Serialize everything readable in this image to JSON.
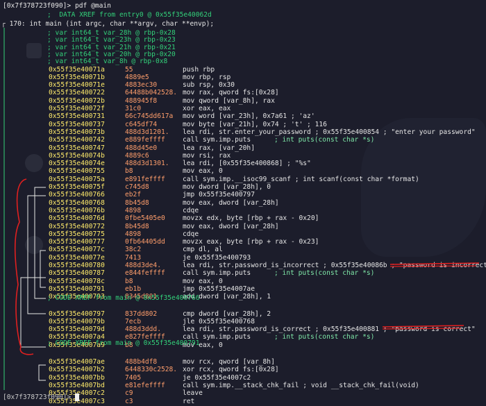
{
  "terminal": {
    "prompt_top": "[0x7f378723f090]> pdf @main",
    "prompt_bottom": "[0x7f378723f090]> ",
    "xref_entry": ";  DATA XREF from entry0 @ 0x55f35e40062d",
    "func_header": "170: int main (int argc, char **argv, char **envp);",
    "vars": [
      "; var int64_t var_28h @ rbp-0x28",
      "; var int64_t var_23h @ rbp-0x23",
      "; var int64_t var_21h @ rbp-0x21",
      "; var int64_t var_20h @ rbp-0x20",
      "; var int64_t var_8h @ rbp-0x8"
    ],
    "code_xref_1": "; CODE XREF from main @ 0x55f35e400766",
    "code_xref_2": "; CODE XREF from main @ 0x55f35e400791",
    "instructions": [
      {
        "addr": "0x55f35e40071a",
        "hex": "55",
        "mn": "push rbp",
        "cmt": ""
      },
      {
        "addr": "0x55f35e40071b",
        "hex": "4889e5",
        "mn": "mov rbp, rsp",
        "cmt": ""
      },
      {
        "addr": "0x55f35e40071e",
        "hex": "4883ec30",
        "mn": "sub rsp, 0x30",
        "cmt": ""
      },
      {
        "addr": "0x55f35e400722",
        "hex": "64488b042528.",
        "mn": "mov rax, qword fs:[0x28]",
        "cmt": ""
      },
      {
        "addr": "0x55f35e40072b",
        "hex": "488945f8",
        "mn": "mov qword [var_8h], rax",
        "cmt": ""
      },
      {
        "addr": "0x55f35e40072f",
        "hex": "31c0",
        "mn": "xor eax, eax",
        "cmt": ""
      },
      {
        "addr": "0x55f35e400731",
        "hex": "66c745dd617a",
        "mn": "mov word [var_23h], 0x7a61 ; 'az'",
        "cmt": ""
      },
      {
        "addr": "0x55f35e400737",
        "hex": "c645df74",
        "mn": "mov byte [var_21h], 0x74 ; 't' ; 116",
        "cmt": ""
      },
      {
        "addr": "0x55f35e40073b",
        "hex": "488d3d1201.",
        "mn": "lea rdi, str.enter_your_password ; 0x55f35e400854 ; \"enter your password\"",
        "cmt": ""
      },
      {
        "addr": "0x55f35e400742",
        "hex": "e889feffff",
        "mn": "call sym.imp.puts",
        "cmt": "; int puts(const char *s)"
      },
      {
        "addr": "0x55f35e400747",
        "hex": "488d45e0",
        "mn": "lea rax, [var_20h]",
        "cmt": ""
      },
      {
        "addr": "0x55f35e40074b",
        "hex": "4889c6",
        "mn": "mov rsi, rax",
        "cmt": ""
      },
      {
        "addr": "0x55f35e40074e",
        "hex": "488d3d1301.",
        "mn": "lea rdi, [0x55f35e400868] ; \"%s\"",
        "cmt": ""
      },
      {
        "addr": "0x55f35e400755",
        "hex": "b8",
        "mn": "mov eax, 0",
        "cmt": ""
      },
      {
        "addr": "0x55f35e40075a",
        "hex": "e891feffff",
        "mn": "call sym.imp.__isoc99_scanf ; int scanf(const char *format)",
        "cmt": ""
      },
      {
        "addr": "0x55f35e40075f",
        "hex": "c745d8",
        "mn": "mov dword [var_28h], 0",
        "cmt": ""
      },
      {
        "addr": "0x55f35e400766",
        "hex": "eb2f",
        "mn": "jmp 0x55f35e400797",
        "cmt": ""
      },
      {
        "addr": "0x55f35e400768",
        "hex": "8b45d8",
        "mn": "mov eax, dword [var_28h]",
        "cmt": ""
      },
      {
        "addr": "0x55f35e40076b",
        "hex": "4898",
        "mn": "cdqe",
        "cmt": ""
      },
      {
        "addr": "0x55f35e40076d",
        "hex": "0fbe5405e0",
        "mn": "movzx edx, byte [rbp + rax - 0x20]",
        "cmt": ""
      },
      {
        "addr": "0x55f35e400772",
        "hex": "8b45d8",
        "mn": "mov eax, dword [var_28h]",
        "cmt": ""
      },
      {
        "addr": "0x55f35e400775",
        "hex": "4898",
        "mn": "cdqe",
        "cmt": ""
      },
      {
        "addr": "0x55f35e400777",
        "hex": "0fb64405dd",
        "mn": "movzx eax, byte [rbp + rax - 0x23]",
        "cmt": ""
      },
      {
        "addr": "0x55f35e40077c",
        "hex": "38c2",
        "mn": "cmp dl, al",
        "cmt": ""
      },
      {
        "addr": "0x55f35e40077e",
        "hex": "7413",
        "mn": "je 0x55f35e400793",
        "cmt": ""
      },
      {
        "addr": "0x55f35e400780",
        "hex": "488d3de4.",
        "mn": "lea rdi, str.password_is_incorrect ; 0x55f35e40086b ; \"password is incorrect\"",
        "cmt": ""
      },
      {
        "addr": "0x55f35e400787",
        "hex": "e844feffff",
        "mn": "call sym.imp.puts",
        "cmt": "; int puts(const char *s)"
      },
      {
        "addr": "0x55f35e40078c",
        "hex": "b8",
        "mn": "mov eax, 0",
        "cmt": ""
      },
      {
        "addr": "0x55f35e400791",
        "hex": "eb1b",
        "mn": "jmp 0x55f35e4007ae",
        "cmt": ""
      },
      {
        "addr": "0x55f35e400793",
        "hex": "8345d801",
        "mn": "add dword [var_28h], 1",
        "cmt": ""
      },
      {
        "addr": "0x55f35e400797",
        "hex": "837dd802",
        "mn": "cmp dword [var_28h], 2",
        "cmt": ""
      },
      {
        "addr": "0x55f35e40079b",
        "hex": "7ecb",
        "mn": "jle 0x55f35e400768",
        "cmt": ""
      },
      {
        "addr": "0x55f35e40079d",
        "hex": "488d3ddd.",
        "mn": "lea rdi, str.password_is_correct ; 0x55f35e400881 ; \"password is correct\"",
        "cmt": ""
      },
      {
        "addr": "0x55f35e4007a4",
        "hex": "e827feffff",
        "mn": "call sym.imp.puts",
        "cmt": "; int puts(const char *s)"
      },
      {
        "addr": "0x55f35e4007a9",
        "hex": "b8",
        "mn": "mov eax, 0",
        "cmt": ""
      },
      {
        "addr": "0x55f35e4007ae",
        "hex": "488b4df8",
        "mn": "mov rcx, qword [var_8h]",
        "cmt": ""
      },
      {
        "addr": "0x55f35e4007b2",
        "hex": "6448330c2528.",
        "mn": "xor rcx, qword fs:[0x28]",
        "cmt": ""
      },
      {
        "addr": "0x55f35e4007bb",
        "hex": "7405",
        "mn": "je 0x55f35e4007c2",
        "cmt": ""
      },
      {
        "addr": "0x55f35e4007bd",
        "hex": "e81efeffff",
        "mn": "call sym.imp.__stack_chk_fail ; void __stack_chk_fail(void)",
        "cmt": ""
      },
      {
        "addr": "0x55f35e4007c2",
        "hex": "c9",
        "mn": "leave",
        "cmt": ""
      },
      {
        "addr": "0x55f35e4007c3",
        "hex": "c3",
        "mn": "ret",
        "cmt": ""
      }
    ]
  },
  "colors": {
    "background": "#1c1d2b",
    "annotation_red": "#e02020"
  }
}
